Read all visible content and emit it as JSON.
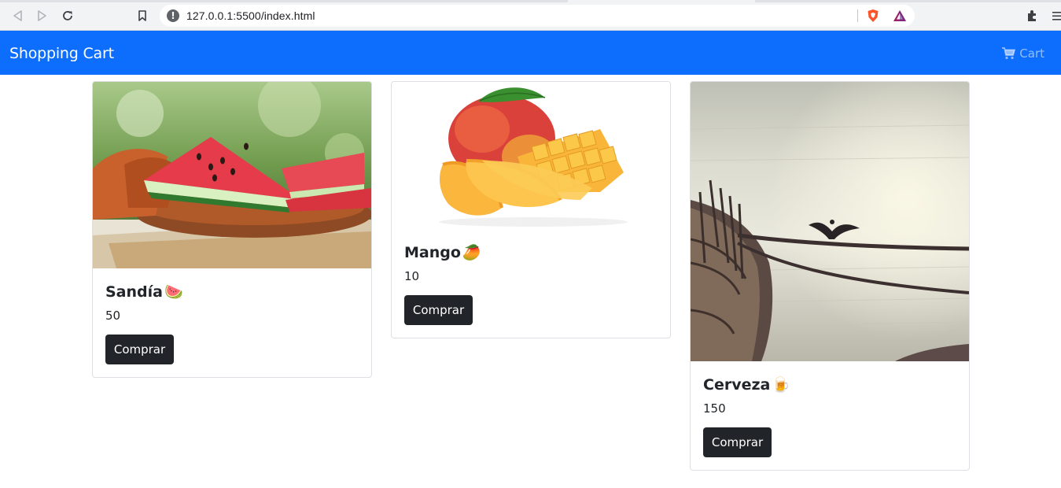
{
  "browser": {
    "url": "127.0.0.1:5500/index.html",
    "icons": [
      "back-icon",
      "forward-icon",
      "reload-icon",
      "bookmark-icon",
      "site-info-icon",
      "brave-shield-icon",
      "brave-rewards-icon",
      "extensions-icon",
      "menu-icon"
    ]
  },
  "navbar": {
    "brand": "Shopping Cart",
    "cart_label": "Cart",
    "bg_color": "#0d6efd"
  },
  "products": [
    {
      "name": "Sandía",
      "emoji": "🍉",
      "price": "50",
      "button": "Comprar",
      "image": "watermelon"
    },
    {
      "name": "Mango",
      "emoji": "🥭",
      "price": "10",
      "button": "Comprar",
      "image": "mango"
    },
    {
      "name": "Cerveza",
      "emoji": "🍺",
      "price": "150",
      "button": "Comprar",
      "image": "boat-bird"
    }
  ],
  "colors": {
    "button_bg": "#212529",
    "primary": "#0d6efd"
  }
}
